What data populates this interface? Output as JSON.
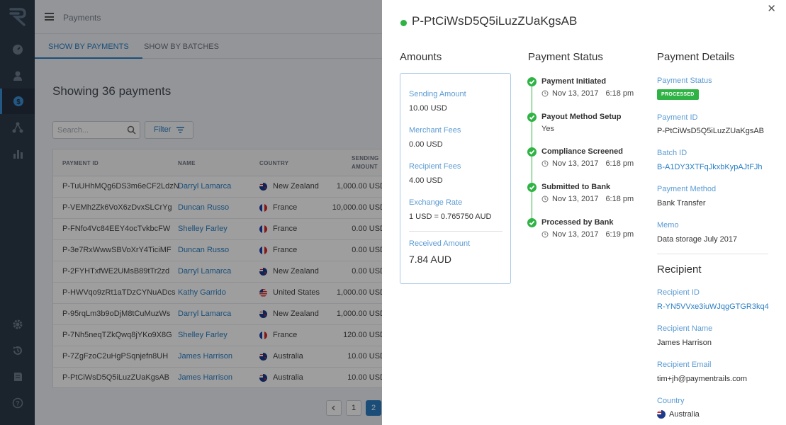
{
  "header": {
    "title": "Payments"
  },
  "tabs": [
    {
      "label": "SHOW BY PAYMENTS",
      "active": true
    },
    {
      "label": "SHOW BY BATCHES",
      "active": false
    }
  ],
  "list": {
    "showing": "Showing 36 payments",
    "search_placeholder": "Search...",
    "filter_label": "Filter",
    "columns": [
      "PAYMENT ID",
      "NAME",
      "COUNTRY",
      "SENDING",
      "AMOUNT"
    ],
    "rows": [
      {
        "id": "P-TuUHhMQg6DS3m6eCF2LdzN",
        "name": "Darryl Lamarca",
        "country": "New Zealand",
        "flag": "nz",
        "amount": "1,000.00 USD"
      },
      {
        "id": "P-VEMh2Zk6VoX6zDvxSLCrYg",
        "name": "Duncan Russo",
        "country": "France",
        "flag": "fr",
        "amount": "10,000.00 USD"
      },
      {
        "id": "P-FNfo4Vc84EEY4ocTvkbcFW",
        "name": "Shelley Farley",
        "country": "France",
        "flag": "fr",
        "amount": "0.00 USD"
      },
      {
        "id": "P-3e7RxWwwSBVoXrY4TiciMF",
        "name": "Duncan Russo",
        "country": "France",
        "flag": "fr",
        "amount": "0.00 USD"
      },
      {
        "id": "P-2FYHTxfWE2UMsB89tTr2zd",
        "name": "Darryl Lamarca",
        "country": "New Zealand",
        "flag": "nz",
        "amount": "0.00 USD"
      },
      {
        "id": "P-HWVqo9zRt1aTDzCYNuADcs",
        "name": "Kathy Garrido",
        "country": "United States",
        "flag": "us",
        "amount": "1,000.00 USD"
      },
      {
        "id": "P-95rqLm3b9oDjM8tCuMuzWs",
        "name": "Darryl Lamarca",
        "country": "New Zealand",
        "flag": "nz",
        "amount": "1,000.00 USD"
      },
      {
        "id": "P-7Nh5neqTZkQwq8jYKo9X8G",
        "name": "Shelley Farley",
        "country": "France",
        "flag": "fr",
        "amount": "120.00 USD"
      },
      {
        "id": "P-7ZgFzoC2uHgPSqnjefn8UH",
        "name": "James Harrison",
        "country": "Australia",
        "flag": "au",
        "amount": "10.00 USD"
      },
      {
        "id": "P-PtCiWsD5Q5iLuzZUaKgsAB",
        "name": "James Harrison",
        "country": "Australia",
        "flag": "au",
        "amount": "10.00 USD"
      }
    ],
    "pages": [
      "1",
      "2"
    ],
    "current_page": "2"
  },
  "drawer": {
    "title": "P-PtCiWsD5Q5iLuzZUaKgsAB",
    "amounts": {
      "heading": "Amounts",
      "sending_label": "Sending Amount",
      "sending_value": "10.00 USD",
      "merchant_label": "Merchant Fees",
      "merchant_value": "0.00 USD",
      "recipient_fees_label": "Recipient Fees",
      "recipient_fees_value": "4.00 USD",
      "rate_label": "Exchange Rate",
      "rate_value": "1 USD = 0.765750 AUD",
      "received_label": "Received Amount",
      "received_value": "7.84 AUD"
    },
    "status": {
      "heading": "Payment Status",
      "steps": [
        {
          "title": "Payment Initiated",
          "date": "Nov 13, 2017",
          "time": "6:18 pm"
        },
        {
          "title": "Payout Method Setup",
          "sub": "Yes"
        },
        {
          "title": "Compliance Screened",
          "date": "Nov 13, 2017",
          "time": "6:18 pm"
        },
        {
          "title": "Submitted to Bank",
          "date": "Nov 13, 2017",
          "time": "6:18 pm"
        },
        {
          "title": "Processed by Bank",
          "date": "Nov 13, 2017",
          "time": "6:19 pm"
        }
      ]
    },
    "details": {
      "heading": "Payment Details",
      "status_label": "Payment Status",
      "status_badge": "PROCESSED",
      "id_label": "Payment ID",
      "id_value": "P-PtCiWsD5Q5iLuzZUaKgsAB",
      "batch_label": "Batch ID",
      "batch_value": "B-A1DY3XTFqJkxbKypAJtFJh",
      "method_label": "Payment Method",
      "method_value": "Bank Transfer",
      "memo_label": "Memo",
      "memo_value": "Data storage July 2017"
    },
    "recipient": {
      "heading": "Recipient",
      "id_label": "Recipient ID",
      "id_value": "R-YN5VVxe3iuWJqgGTGR3kq4",
      "name_label": "Recipient Name",
      "name_value": "James Harrison",
      "email_label": "Recipient Email",
      "email_value": "tim+jh@paymentrails.com",
      "country_label": "Country",
      "country_value": "Australia"
    }
  },
  "colors": {
    "accent": "#2a7fc4",
    "success": "#2fb344",
    "sidebar": "#2c3948"
  }
}
